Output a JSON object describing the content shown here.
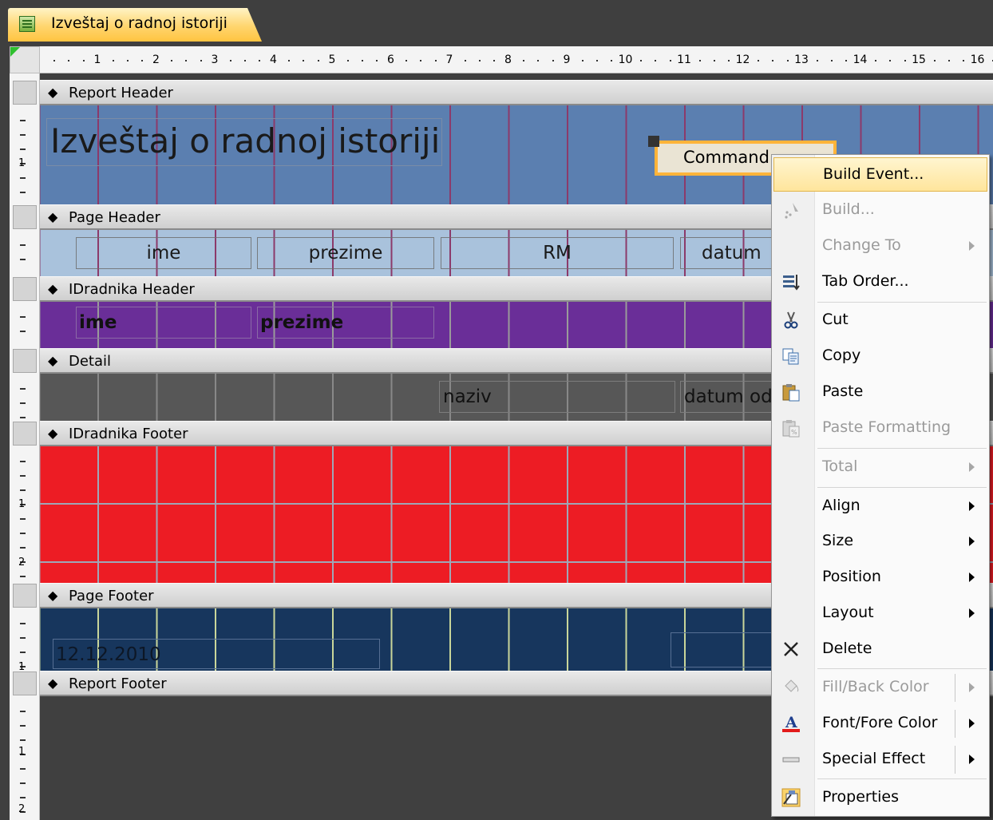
{
  "tab": {
    "title": "Izveštaj o radnoj istoriji",
    "icon": "report-icon"
  },
  "rulers": {
    "h_numbers": [
      "1",
      "2",
      "3",
      "4",
      "5",
      "6",
      "7",
      "8",
      "9",
      "10",
      "11",
      "12",
      "13",
      "14",
      "15",
      "16"
    ],
    "v_numbers": [
      "1",
      "1",
      "2",
      "1",
      "1",
      "2"
    ]
  },
  "sections": {
    "report_header": "Report Header",
    "page_header": "Page Header",
    "group_header": "IDradnika Header",
    "detail": "Detail",
    "group_footer": "IDradnika Footer",
    "page_footer": "Page Footer",
    "report_footer": "Report Footer"
  },
  "report_header": {
    "title": "Izveštaj o radnoj istoriji",
    "command_button": "Command"
  },
  "page_header": {
    "labels": [
      "ime",
      "prezime",
      "RM",
      "datum"
    ]
  },
  "group_header": {
    "fields": [
      "ime",
      "prezime"
    ]
  },
  "detail": {
    "fields": [
      "naziv",
      "datum od"
    ]
  },
  "page_footer": {
    "date": "12.12.2010"
  },
  "context_menu": {
    "items": [
      {
        "label": "Build Event...",
        "state": "highlighted",
        "submenu": false
      },
      {
        "label": "Build...",
        "state": "disabled",
        "icon": "build-icon",
        "submenu": false
      },
      {
        "label": "Change To",
        "state": "disabled",
        "submenu": true
      },
      {
        "label": "Tab Order...",
        "state": "enabled",
        "icon": "tab-order-icon",
        "submenu": false
      },
      {
        "label": "Cut",
        "state": "enabled",
        "icon": "scissors-icon",
        "submenu": false
      },
      {
        "label": "Copy",
        "state": "enabled",
        "icon": "copy-icon",
        "submenu": false
      },
      {
        "label": "Paste",
        "state": "enabled",
        "icon": "paste-icon",
        "submenu": false
      },
      {
        "label": "Paste Formatting",
        "state": "disabled",
        "icon": "paste-formatting-icon",
        "submenu": false
      },
      {
        "label": "Total",
        "state": "disabled",
        "submenu": true
      },
      {
        "label": "Align",
        "state": "enabled",
        "submenu": true
      },
      {
        "label": "Size",
        "state": "enabled",
        "submenu": true
      },
      {
        "label": "Position",
        "state": "enabled",
        "submenu": true
      },
      {
        "label": "Layout",
        "state": "enabled",
        "submenu": true
      },
      {
        "label": "Delete",
        "state": "enabled",
        "icon": "delete-x-icon",
        "submenu": false
      },
      {
        "label": "Fill/Back Color",
        "state": "disabled",
        "icon": "fill-color-icon",
        "submenu": true
      },
      {
        "label": "Font/Fore Color",
        "state": "enabled",
        "icon": "font-color-icon",
        "submenu": true
      },
      {
        "label": "Special Effect",
        "state": "enabled",
        "icon": "special-effect-icon",
        "submenu": true
      },
      {
        "label": "Properties",
        "state": "enabled",
        "icon": "properties-icon",
        "submenu": false
      }
    ]
  },
  "colors": {
    "report_header_bg": "#5b7fb0",
    "page_header_bg": "#a9c2dc",
    "group_header_bg": "#6a2e98",
    "detail_bg": "#575757",
    "group_footer_bg": "#ed1c24",
    "page_footer_bg": "#17365d",
    "report_footer_bg": "#404040",
    "menu_highlight": "#ffe59c"
  }
}
